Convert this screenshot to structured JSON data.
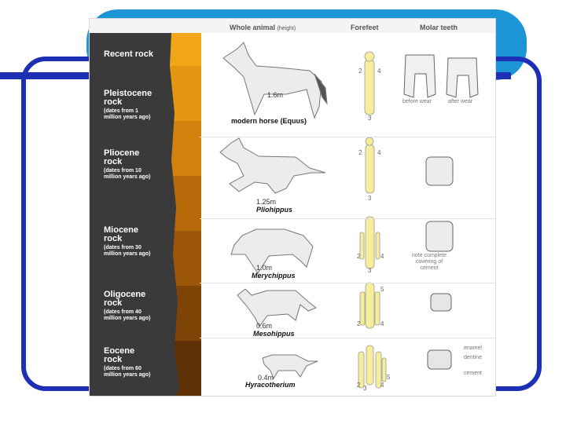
{
  "slide": {
    "accent": "#1d2fb5",
    "tab": "#1b95d6"
  },
  "headers": {
    "whole_animal": "Whole animal",
    "height_note": "(height)",
    "forefeet": "Forefeet",
    "molar_teeth": "Molar teeth"
  },
  "rocks": [
    {
      "name": "Recent rock",
      "age": ""
    },
    {
      "name": "Pleistocene\nrock",
      "age": "(dates from 1\nmillion years ago)"
    },
    {
      "name": "Pliocene\nrock",
      "age": "(dates from 10\nmillion years ago)"
    },
    {
      "name": "Miocene\nrock",
      "age": "(dates from 30\nmillion years ago)"
    },
    {
      "name": "Oligocene\nrock",
      "age": "(dates from 40\nmillion years ago)"
    },
    {
      "name": "Eocene\nrock",
      "age": "(dates from 60\nmillion years ago)"
    }
  ],
  "animals": [
    {
      "height": "1.6m",
      "species": "modern horse (Equus)"
    },
    {
      "height": "1.25m",
      "species": "Pliohippus"
    },
    {
      "height": "1.0m",
      "species": "Merychippus"
    },
    {
      "height": "0.6m",
      "species": "Mesohippus"
    },
    {
      "height": "0.4m",
      "species": "Hyracotherium"
    }
  ],
  "digits": [
    "2",
    "4",
    "3",
    "5"
  ],
  "teeth_notes": {
    "before_wear": "before wear",
    "after_wear": "after wear",
    "cement_note": "note complete\ncovering of\ncement",
    "enamel": "enamel",
    "dentine": "dentine",
    "cement": "cement"
  },
  "strata_colors": [
    "#f2a516",
    "#e79a14",
    "#d88910",
    "#c67a10",
    "#a9620c",
    "#8c4e0a",
    "#6e3a06",
    "#522806"
  ]
}
